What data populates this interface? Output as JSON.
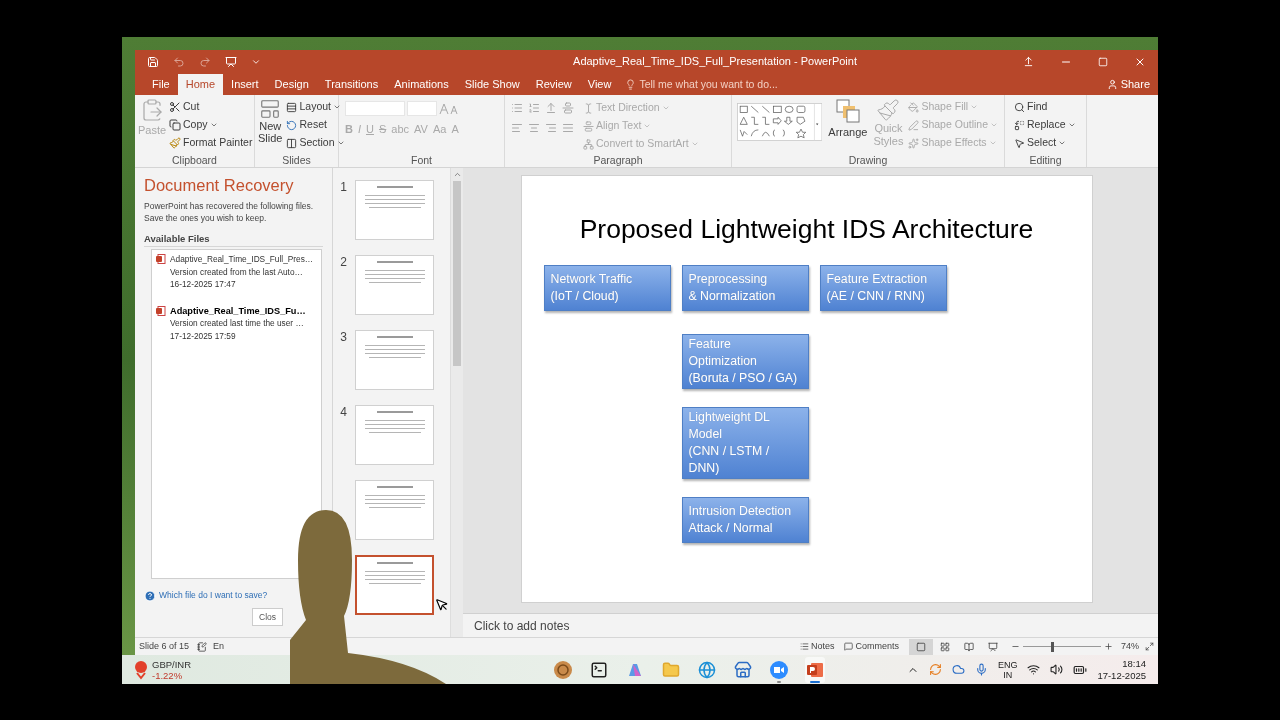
{
  "window": {
    "title": "Adaptive_Real_Time_IDS_Full_Presentation - PowerPoint"
  },
  "tabs": [
    {
      "label": "File",
      "selected": false
    },
    {
      "label": "Home",
      "selected": true
    },
    {
      "label": "Insert",
      "selected": false
    },
    {
      "label": "Design",
      "selected": false
    },
    {
      "label": "Transitions",
      "selected": false
    },
    {
      "label": "Animations",
      "selected": false
    },
    {
      "label": "Slide Show",
      "selected": false
    },
    {
      "label": "Review",
      "selected": false
    },
    {
      "label": "View",
      "selected": false
    }
  ],
  "tell_me": {
    "placeholder": "Tell me what you want to do..."
  },
  "share": "Share",
  "ribbon": {
    "clipboard": {
      "label": "Clipboard",
      "paste": {
        "label": "Paste",
        "disabled": true
      },
      "cut": "Cut",
      "copy": "Copy",
      "format_painter": "Format Painter"
    },
    "slides": {
      "label": "Slides",
      "new_slide": [
        "New",
        "Slide"
      ],
      "layout": "Layout",
      "reset": "Reset",
      "section": "Section"
    },
    "font": {
      "label": "Font",
      "disabled": true,
      "buttons": [
        "B",
        "I",
        "U",
        "S",
        "abc",
        "AV",
        "Aa",
        "A"
      ]
    },
    "paragraph": {
      "label": "Paragraph",
      "disabled": true,
      "text_direction": "Text Direction",
      "align_text": "Align Text",
      "convert_smartart": "Convert to SmartArt"
    },
    "drawing": {
      "label": "Drawing",
      "arrange": "Arrange",
      "quick_styles": {
        "lines": [
          "Quick",
          "Styles"
        ],
        "disabled": true
      },
      "shape_format": {
        "disabled": true,
        "items": [
          "Shape Fill",
          "Shape Outline",
          "Shape Effects"
        ]
      }
    },
    "editing": {
      "label": "Editing",
      "find": "Find",
      "replace": "Replace",
      "select": "Select"
    }
  },
  "recovery": {
    "title": "Document Recovery",
    "description": "PowerPoint has recovered the following files. Save the ones you wish to keep.",
    "files_heading": "Available Files",
    "files": [
      {
        "name": "Adaptive_Real_Time_IDS_Full_Pres…",
        "detail": "Version created from the last Auto…",
        "date": "16-12-2025 17:47",
        "emphasized": false
      },
      {
        "name": "Adaptive_Real_Time_IDS_Fu…",
        "detail": "Version created last time the user …",
        "date": "17-12-2025 17:59",
        "emphasized": true
      }
    ],
    "help_link": "Which file do I want to save?",
    "close_button": "Clos"
  },
  "thumbnails": [
    {
      "number": "1",
      "selected": false
    },
    {
      "number": "2",
      "selected": false
    },
    {
      "number": "3",
      "selected": false
    },
    {
      "number": "4",
      "selected": false
    },
    {
      "selected": false
    },
    {
      "selected": true
    }
  ],
  "slide": {
    "title": "Proposed Lightweight IDS Architecture",
    "top_row": [
      {
        "lines": [
          "Network Traffic",
          "(IoT / Cloud)"
        ]
      },
      {
        "lines": [
          "Preprocessing",
          "& Normalization"
        ]
      },
      {
        "lines": [
          "Feature Extraction",
          "(AE / CNN / RNN)"
        ]
      }
    ],
    "column": [
      {
        "lines": [
          "Feature",
          "Optimization",
          "(Boruta / PSO / GA)"
        ]
      },
      {
        "lines": [
          "Lightweight DL",
          "Model",
          "(CNN / LSTM /",
          "DNN)"
        ]
      },
      {
        "lines": [
          "Intrusion Detection",
          "Attack / Normal"
        ]
      }
    ]
  },
  "notes": {
    "placeholder": "Click to add notes"
  },
  "status_bar": {
    "slide_info": "Slide 6 of 15",
    "language": "En",
    "notes": "Notes",
    "comments": "Comments",
    "views": [
      {
        "selected": true
      },
      {
        "selected": false
      },
      {
        "selected": false
      },
      {
        "selected": false
      }
    ],
    "zoom_slider": {
      "level": 0.36
    },
    "zoom": "74%"
  },
  "taskbar": {
    "widget": {
      "name": "GBP/INR",
      "change": "-1.22%"
    },
    "apps": [
      {
        "running": false,
        "active": false
      },
      {
        "running": false,
        "active": false
      },
      {
        "running": false,
        "active": false
      },
      {
        "running": false,
        "active": false
      },
      {
        "running": false,
        "active": false
      },
      {
        "running": false,
        "active": false
      },
      {
        "running": true,
        "active": false
      },
      {
        "running": true,
        "active": true
      }
    ],
    "language": [
      "ENG",
      "IN"
    ],
    "time": "18:14",
    "date": "17-12-2025"
  }
}
